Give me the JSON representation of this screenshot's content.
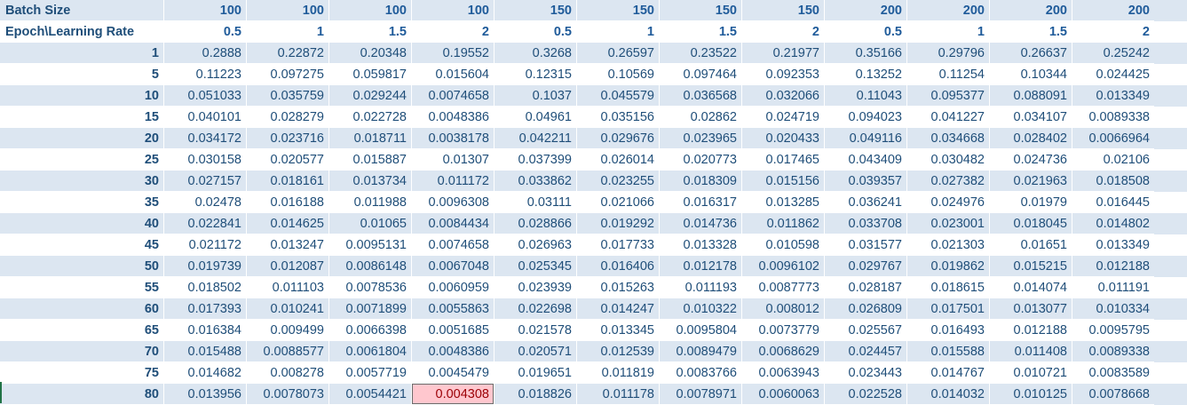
{
  "sheet": {
    "row_batch_label": "Batch Size",
    "row_lr_label": "Epoch\\Learning Rate",
    "batch_sizes": [
      "100",
      "100",
      "100",
      "100",
      "150",
      "150",
      "150",
      "150",
      "200",
      "200",
      "200",
      "200"
    ],
    "learning_rates": [
      "0.5",
      "1",
      "1.5",
      "2",
      "0.5",
      "1",
      "1.5",
      "2",
      "0.5",
      "1",
      "1.5",
      "2"
    ],
    "epochs": [
      "1",
      "5",
      "10",
      "15",
      "20",
      "25",
      "30",
      "35",
      "40",
      "45",
      "50",
      "55",
      "60",
      "65",
      "70",
      "75",
      "80"
    ],
    "rows": [
      [
        "0.2888",
        "0.22872",
        "0.20348",
        "0.19552",
        "0.3268",
        "0.26597",
        "0.23522",
        "0.21977",
        "0.35166",
        "0.29796",
        "0.26637",
        "0.25242"
      ],
      [
        "0.11223",
        "0.097275",
        "0.059817",
        "0.015604",
        "0.12315",
        "0.10569",
        "0.097464",
        "0.092353",
        "0.13252",
        "0.11254",
        "0.10344",
        "0.024425"
      ],
      [
        "0.051033",
        "0.035759",
        "0.029244",
        "0.0074658",
        "0.1037",
        "0.045579",
        "0.036568",
        "0.032066",
        "0.11043",
        "0.095377",
        "0.088091",
        "0.013349"
      ],
      [
        "0.040101",
        "0.028279",
        "0.022728",
        "0.0048386",
        "0.04961",
        "0.035156",
        "0.02862",
        "0.024719",
        "0.094023",
        "0.041227",
        "0.034107",
        "0.0089338"
      ],
      [
        "0.034172",
        "0.023716",
        "0.018711",
        "0.0038178",
        "0.042211",
        "0.029676",
        "0.023965",
        "0.020433",
        "0.049116",
        "0.034668",
        "0.028402",
        "0.0066964"
      ],
      [
        "0.030158",
        "0.020577",
        "0.015887",
        "0.01307",
        "0.037399",
        "0.026014",
        "0.020773",
        "0.017465",
        "0.043409",
        "0.030482",
        "0.024736",
        "0.02106"
      ],
      [
        "0.027157",
        "0.018161",
        "0.013734",
        "0.011172",
        "0.033862",
        "0.023255",
        "0.018309",
        "0.015156",
        "0.039357",
        "0.027382",
        "0.021963",
        "0.018508"
      ],
      [
        "0.02478",
        "0.016188",
        "0.011988",
        "0.0096308",
        "0.03111",
        "0.021066",
        "0.016317",
        "0.013285",
        "0.036241",
        "0.024976",
        "0.01979",
        "0.016445"
      ],
      [
        "0.022841",
        "0.014625",
        "0.01065",
        "0.0084434",
        "0.028866",
        "0.019292",
        "0.014736",
        "0.011862",
        "0.033708",
        "0.023001",
        "0.018045",
        "0.014802"
      ],
      [
        "0.021172",
        "0.013247",
        "0.0095131",
        "0.0074658",
        "0.026963",
        "0.017733",
        "0.013328",
        "0.010598",
        "0.031577",
        "0.021303",
        "0.01651",
        "0.013349"
      ],
      [
        "0.019739",
        "0.012087",
        "0.0086148",
        "0.0067048",
        "0.025345",
        "0.016406",
        "0.012178",
        "0.0096102",
        "0.029767",
        "0.019862",
        "0.015215",
        "0.012188"
      ],
      [
        "0.018502",
        "0.011103",
        "0.0078536",
        "0.0060959",
        "0.023939",
        "0.015263",
        "0.011193",
        "0.0087773",
        "0.028187",
        "0.018615",
        "0.014074",
        "0.011191"
      ],
      [
        "0.017393",
        "0.010241",
        "0.0071899",
        "0.0055863",
        "0.022698",
        "0.014247",
        "0.010322",
        "0.008012",
        "0.026809",
        "0.017501",
        "0.013077",
        "0.010334"
      ],
      [
        "0.016384",
        "0.009499",
        "0.0066398",
        "0.0051685",
        "0.021578",
        "0.013345",
        "0.0095804",
        "0.0073779",
        "0.025567",
        "0.016493",
        "0.012188",
        "0.0095795"
      ],
      [
        "0.015488",
        "0.0088577",
        "0.0061804",
        "0.0048386",
        "0.020571",
        "0.012539",
        "0.0089479",
        "0.0068629",
        "0.024457",
        "0.015588",
        "0.011408",
        "0.0089338"
      ],
      [
        "0.014682",
        "0.008278",
        "0.0057719",
        "0.0045479",
        "0.019651",
        "0.011819",
        "0.0083766",
        "0.0063943",
        "0.023443",
        "0.014767",
        "0.010721",
        "0.0083589"
      ],
      [
        "0.013956",
        "0.0078073",
        "0.0054421",
        "0.004308",
        "0.018826",
        "0.011178",
        "0.0078971",
        "0.0060063",
        "0.022528",
        "0.014032",
        "0.010125",
        "0.0078668"
      ]
    ],
    "highlight": {
      "row": 16,
      "col": 3,
      "fill": "#ffc7ce",
      "text_color": "#9c0006"
    },
    "colors": {
      "band": "#dce6f1",
      "text": "#1f4e79"
    }
  }
}
